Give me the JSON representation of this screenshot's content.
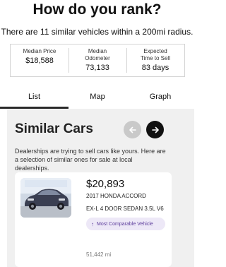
{
  "header": {
    "title": "How do you rank?",
    "subtitle": "There are 11 similar vehicles within a 200mi radius."
  },
  "stats": [
    {
      "label": "Median Price",
      "value": "$18,588"
    },
    {
      "label": "Median Odometer",
      "value": "73,133"
    },
    {
      "label": "Expected Time to Sell",
      "value": "83 days"
    }
  ],
  "tabs": [
    "List",
    "Map",
    "Graph"
  ],
  "active_tab": "List",
  "similar": {
    "title": "Similar Cars",
    "description": "Dealerships are trying to sell cars like yours. Here are a selection of similar ones for sale at local dealerships.",
    "prev_icon": "arrow-left-icon",
    "next_icon": "arrow-right-icon"
  },
  "listing": {
    "price": "$20,893",
    "model": "2017 HONDA ACCORD",
    "trim": "EX-L 4 DOOR SEDAN 3.5L V6",
    "badge": "Most Comparable Vehicle",
    "badge_icon": "arrow-up-icon",
    "mileage": "51,442 mi",
    "car_color": "#3a3f52"
  },
  "colors": {
    "badge_bg": "#ede8f7",
    "badge_text": "#5b3b9b",
    "panel_bg": "#f0f0f0"
  }
}
